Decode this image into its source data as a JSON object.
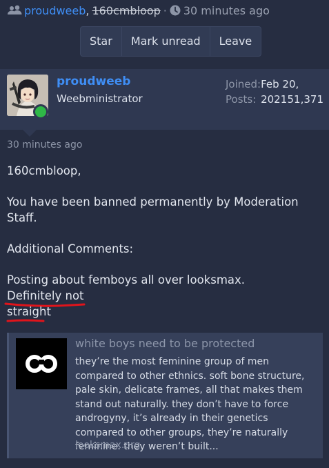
{
  "conversation": {
    "participants": [
      "proudweeb",
      "160cmbloop"
    ],
    "separator": ",",
    "dot": "·",
    "time": "30 minutes ago",
    "users_icon": "users-icon",
    "clock_icon": "clock-icon"
  },
  "actions": [
    "Star",
    "Mark unread",
    "Leave"
  ],
  "author": {
    "username": "proudweeb",
    "title": "Weebministrator",
    "joined_label": "Joined:",
    "joined_value": "Feb 20, 2021",
    "posts_label": "Posts:",
    "posts_value": "51,371",
    "online": true
  },
  "message": {
    "time": "30 minutes ago",
    "greeting": "160cmbloop,",
    "ban_line": "You have been banned permanently by Moderation Staff.",
    "comments_label": "Additional Comments:",
    "comment_lead": "Posting about femboys all over looksmax. ",
    "comment_mark_1": "Definitely not",
    "comment_mark_2": "straight"
  },
  "unfurl": {
    "title": "white boys need to be protected",
    "description": "they’re the most feminine group of men compared to other ethnics. soft bone structure, pale skin, delicate frames, all that makes them stand out naturally. they don’t have to force androgyny, it’s already in their genetics compared to other groups, they’re naturally feminine. they weren’t built...",
    "domain": "looksmax.org",
    "logo_icon": "infinity-loop-icon"
  },
  "colors": {
    "background": "#262d41",
    "link": "#3f8ef5",
    "online": "#2fb847",
    "annotation": "#e0141b"
  }
}
